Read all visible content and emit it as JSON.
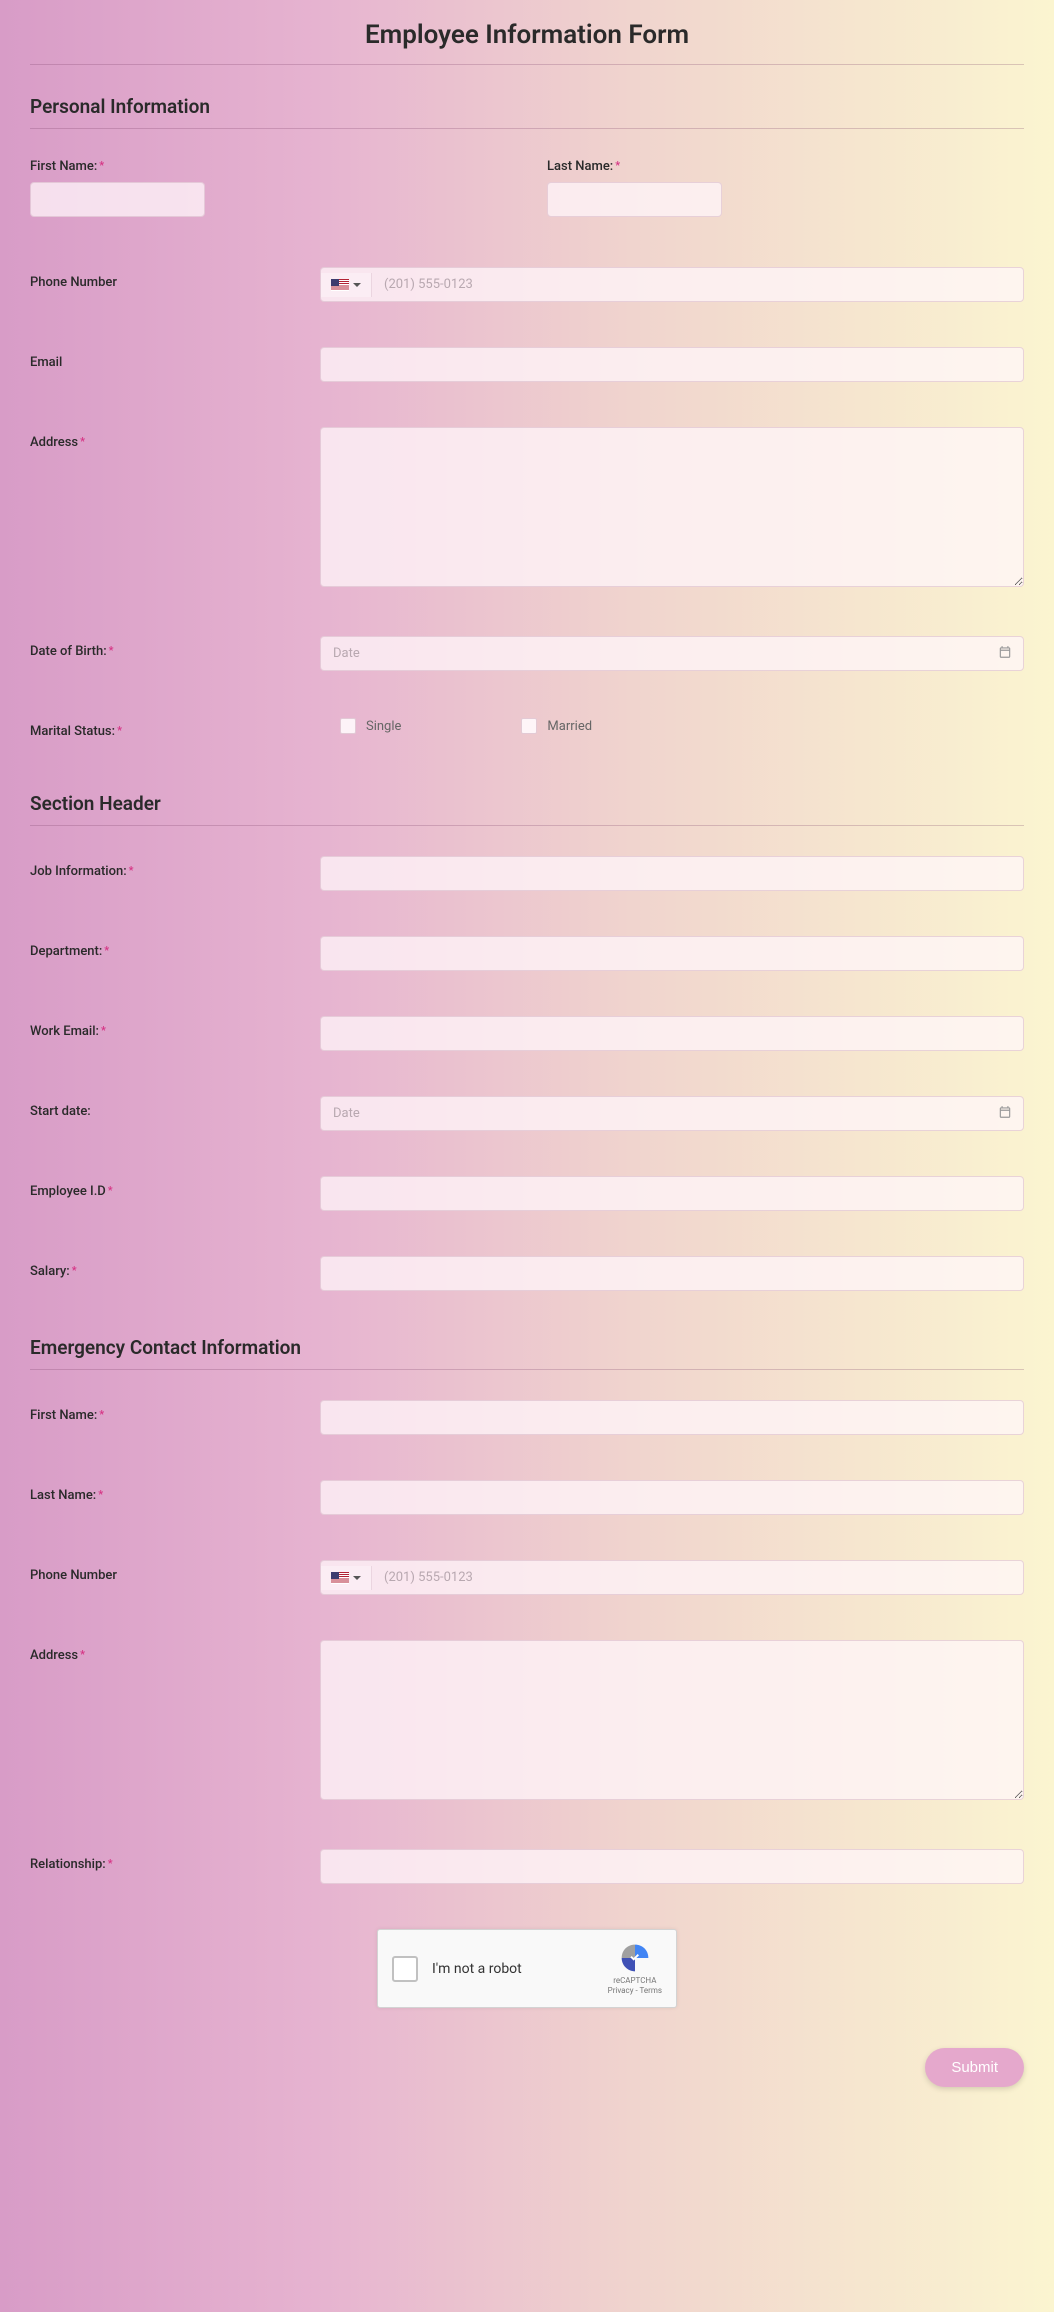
{
  "title": "Employee Information Form",
  "sections": {
    "personal": {
      "header": "Personal Information",
      "first_name_label": "First Name:",
      "last_name_label": "Last Name:",
      "phone_label": "Phone Number",
      "phone_placeholder": "(201) 555-0123",
      "email_label": "Email",
      "address_label": "Address",
      "dob_label": "Date of Birth:",
      "date_placeholder": "Date",
      "marital_label": "Marital Status:",
      "marital_options": {
        "single": "Single",
        "married": "Married"
      }
    },
    "job": {
      "header": "Section Header",
      "job_info_label": "Job Information:",
      "department_label": "Department:",
      "work_email_label": "Work Email:",
      "start_date_label": "Start date:",
      "date_placeholder": "Date",
      "employee_id_label": "Employee I.D",
      "salary_label": "Salary:"
    },
    "emergency": {
      "header": "Emergency Contact Information",
      "first_name_label": "First Name:",
      "last_name_label": "Last Name:",
      "phone_label": "Phone Number",
      "phone_placeholder": "(201) 555-0123",
      "address_label": "Address",
      "relationship_label": "Relationship:"
    }
  },
  "recaptcha": {
    "label": "I'm not a robot",
    "brand": "reCAPTCHA",
    "links": "Privacy - Terms"
  },
  "submit_label": "Submit"
}
